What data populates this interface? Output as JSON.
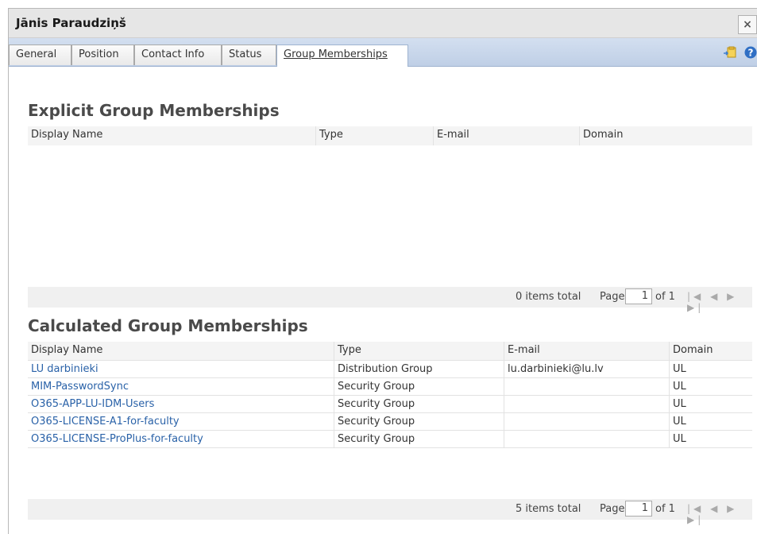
{
  "window": {
    "title": "Jānis Paraudziņš",
    "close_label": "×"
  },
  "tabs": [
    "General",
    "Position",
    "Contact Info",
    "Status",
    "Group Memberships"
  ],
  "explicit": {
    "title": "Explicit Group Memberships",
    "columns": [
      "Display Name",
      "Type",
      "E-mail",
      "Domain"
    ],
    "total": "0 items total",
    "page_label": "Page",
    "page": "1",
    "of": "of 1"
  },
  "calculated": {
    "title": "Calculated Group Memberships",
    "columns": [
      "Display Name",
      "Type",
      "E-mail",
      "Domain"
    ],
    "rows": [
      [
        "LU darbinieki",
        "Distribution Group",
        "lu.darbinieki@lu.lv",
        "UL"
      ],
      [
        "MIM-PasswordSync",
        "Security Group",
        "",
        "UL"
      ],
      [
        "O365-APP-LU-IDM-Users",
        "Security Group",
        "",
        "UL"
      ],
      [
        "O365-LICENSE-A1-for-faculty",
        "Security Group",
        "",
        "UL"
      ],
      [
        "O365-LICENSE-ProPlus-for-faculty",
        "Security Group",
        "",
        "UL"
      ]
    ],
    "total": "5 items total",
    "page_label": "Page",
    "page": "1",
    "of": "of 1"
  },
  "pager_nav": "|◀ ◀ ▶ ▶|"
}
